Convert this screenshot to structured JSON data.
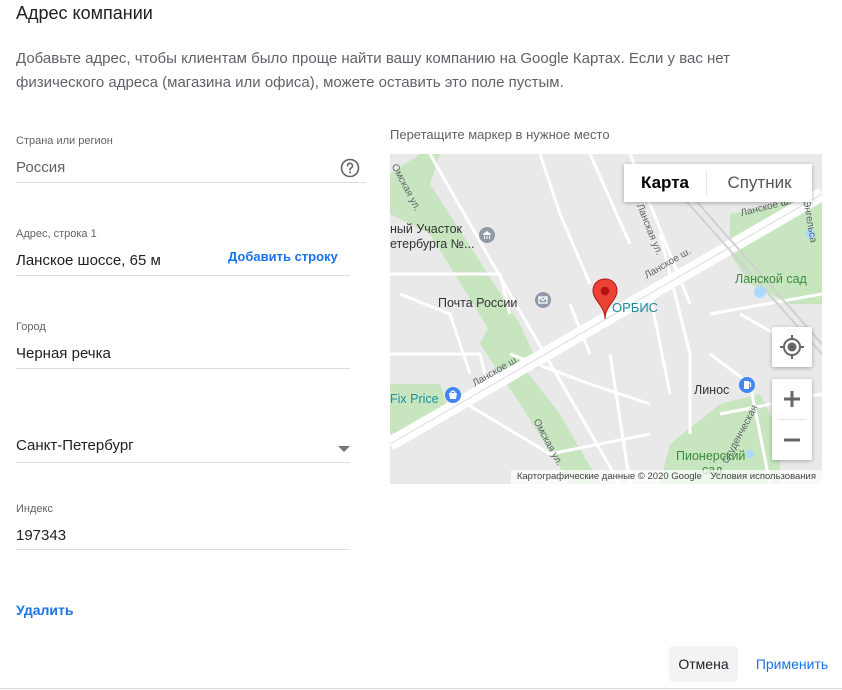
{
  "dialog": {
    "title": "Адрес компании",
    "description": "Добавьте адрес, чтобы клиентам было проще найти вашу компанию на Google Картах. Если у вас нет физического адреса (магазина или офиса), можете оставить это поле пустым."
  },
  "fields": {
    "country": {
      "label": "Страна или регион",
      "value": "Россия"
    },
    "address1": {
      "label": "Адрес, строка 1",
      "value": "Ланское шоссе, 65 м",
      "add_line": "Добавить строку"
    },
    "city": {
      "label": "Город",
      "value": "Черная речка"
    },
    "region": {
      "value": "Санкт-Петербург"
    },
    "postal": {
      "label": "Индекс",
      "value": "197343"
    }
  },
  "remove_label": "Удалить",
  "map": {
    "instruction": "Перетащите маркер в нужное место",
    "type_map": "Карта",
    "type_satellite": "Спутник",
    "attribution_data": "Картографические данные © 2020 Google",
    "attribution_terms": "Условия использования",
    "places": {
      "post": "Почта России",
      "orbis": "ОРБИС",
      "fixprice": "Fix Price",
      "linos": "Линос",
      "lansky_garden": "Ланской сад",
      "pioneer_garden_1": "Пионерский",
      "pioneer_garden_2": "сад",
      "police_1": "ный Участок",
      "police_2": "етербурга №...",
      "street_lanskoe_1": "Ланское ш.",
      "street_lanskoe_2": "Ланское ш.",
      "street_lanskoe_3": "Ланское ш.",
      "street_lanskaya": "Ланская ул.",
      "street_omskaya_1": "Омская ул.",
      "street_omskaya_2": "Омская ул.",
      "street_studencheskaya": "Студенческая",
      "street_engelsa": "Энгельса"
    }
  },
  "actions": {
    "cancel": "Отмена",
    "apply": "Применить"
  },
  "colors": {
    "accent": "#1a73e8",
    "marker": "#ea4335",
    "park": "#c7e6c0"
  }
}
